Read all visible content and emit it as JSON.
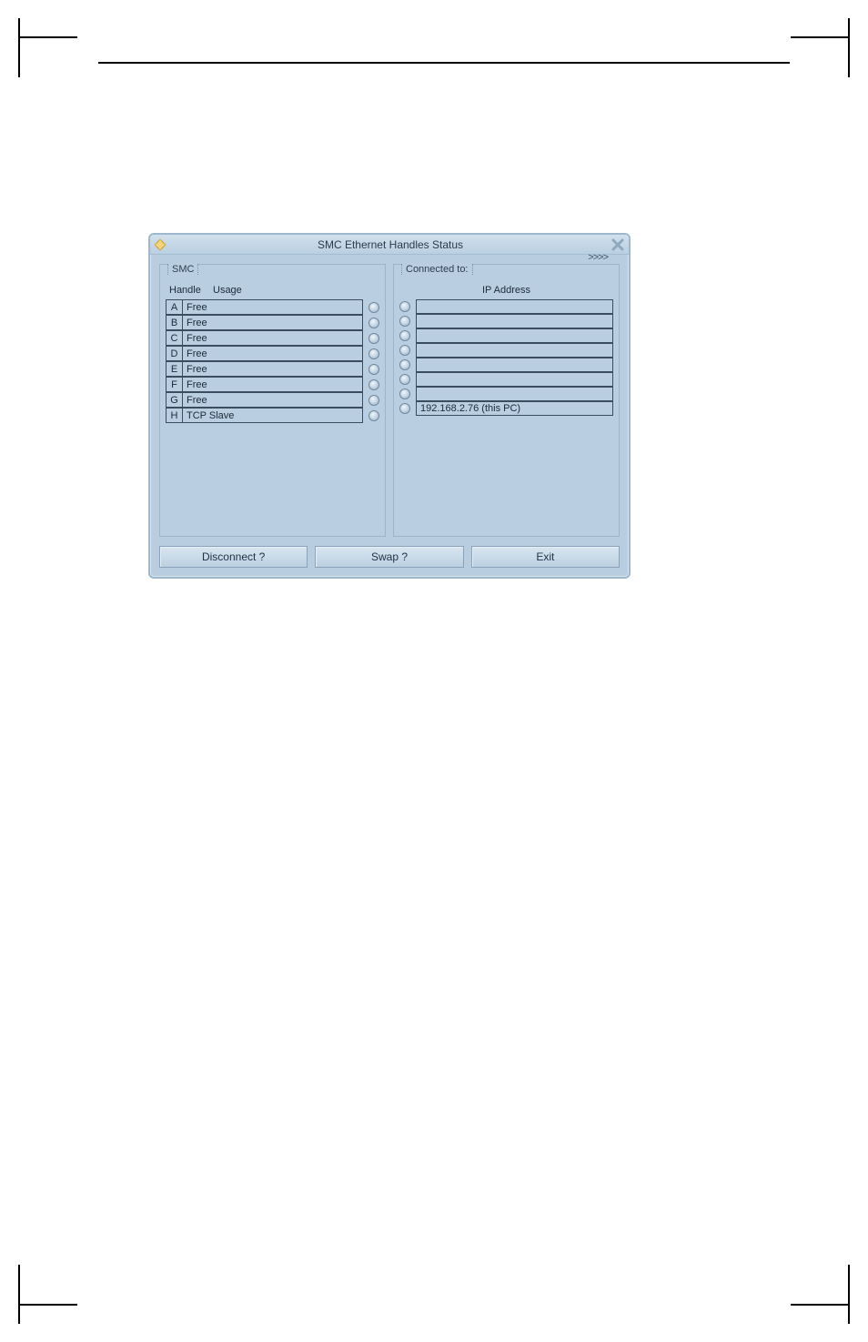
{
  "dialog": {
    "title": "SMC Ethernet Handles Status",
    "chevrons": ">>>>",
    "left_panel": {
      "legend": "SMC",
      "col_handle": "Handle",
      "col_usage": "Usage",
      "rows": [
        {
          "handle": "A",
          "usage": "Free"
        },
        {
          "handle": "B",
          "usage": "Free"
        },
        {
          "handle": "C",
          "usage": "Free"
        },
        {
          "handle": "D",
          "usage": "Free"
        },
        {
          "handle": "E",
          "usage": "Free"
        },
        {
          "handle": "F",
          "usage": "Free"
        },
        {
          "handle": "G",
          "usage": "Free"
        },
        {
          "handle": "H",
          "usage": "TCP Slave"
        }
      ]
    },
    "right_panel": {
      "legend": "Connected to:",
      "col_ip": "IP Address",
      "rows": [
        {
          "ip": ""
        },
        {
          "ip": ""
        },
        {
          "ip": ""
        },
        {
          "ip": ""
        },
        {
          "ip": ""
        },
        {
          "ip": ""
        },
        {
          "ip": ""
        },
        {
          "ip": "192.168.2.76 (this PC)"
        }
      ]
    },
    "buttons": {
      "disconnect": "Disconnect ?",
      "swap": "Swap ?",
      "exit": "Exit"
    }
  }
}
